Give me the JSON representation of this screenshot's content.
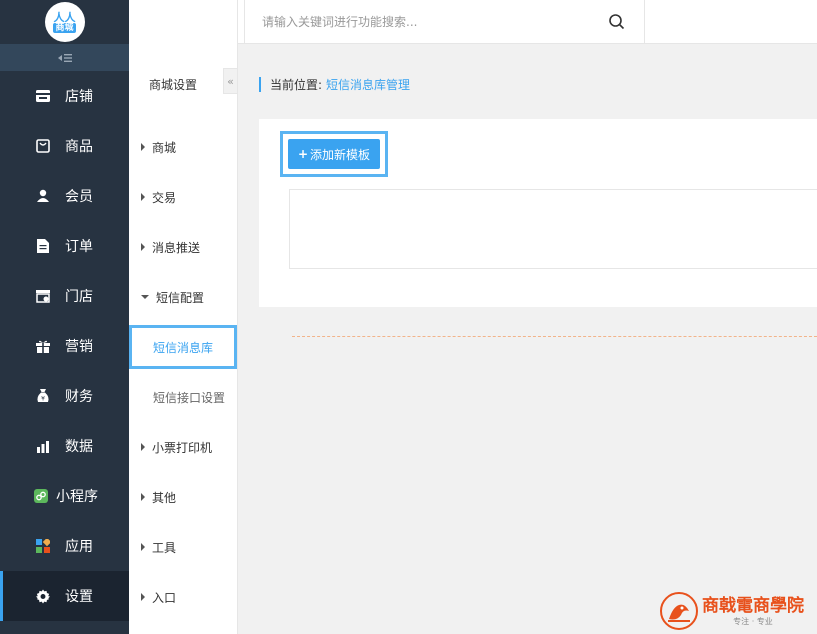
{
  "logo": {
    "line1": "人人",
    "line2": "商城"
  },
  "sidebar": {
    "collapse_icon": "collapse-menu-icon",
    "items": [
      {
        "label": "店铺",
        "icon": "store-icon"
      },
      {
        "label": "商品",
        "icon": "bag-icon"
      },
      {
        "label": "会员",
        "icon": "user-icon"
      },
      {
        "label": "订单",
        "icon": "document-icon"
      },
      {
        "label": "门店",
        "icon": "shop-front-icon"
      },
      {
        "label": "营销",
        "icon": "gift-icon"
      },
      {
        "label": "财务",
        "icon": "money-bag-icon"
      },
      {
        "label": "数据",
        "icon": "bar-chart-icon"
      },
      {
        "label": "小程序",
        "icon": "mini-program-icon"
      },
      {
        "label": "应用",
        "icon": "apps-icon"
      },
      {
        "label": "设置",
        "icon": "gear-icon"
      }
    ]
  },
  "submenu": {
    "title": "商城设置",
    "collapse_glyph": "«",
    "items": [
      {
        "label": "商城"
      },
      {
        "label": "交易"
      },
      {
        "label": "消息推送"
      },
      {
        "label": "短信配置"
      },
      {
        "label": "小票打印机"
      },
      {
        "label": "其他"
      },
      {
        "label": "工具"
      },
      {
        "label": "入口"
      }
    ],
    "children": [
      {
        "label": "短信消息库"
      },
      {
        "label": "短信接口设置"
      }
    ]
  },
  "topbar": {
    "search_placeholder": "请输入关键词进行功能搜索..."
  },
  "main": {
    "breadcrumb_label": "当前位置:",
    "breadcrumb_current": "短信消息库管理",
    "add_button_plus": "+",
    "add_button_label": "添加新模板"
  },
  "watermark": {
    "title": "商戟電商學院",
    "subtitle": "专注 · 专业"
  },
  "colors": {
    "sidebar_bg": "#273341",
    "accent": "#3aa3f0",
    "highlight_border": "#5ab4f2",
    "watermark": "#e8511c"
  }
}
